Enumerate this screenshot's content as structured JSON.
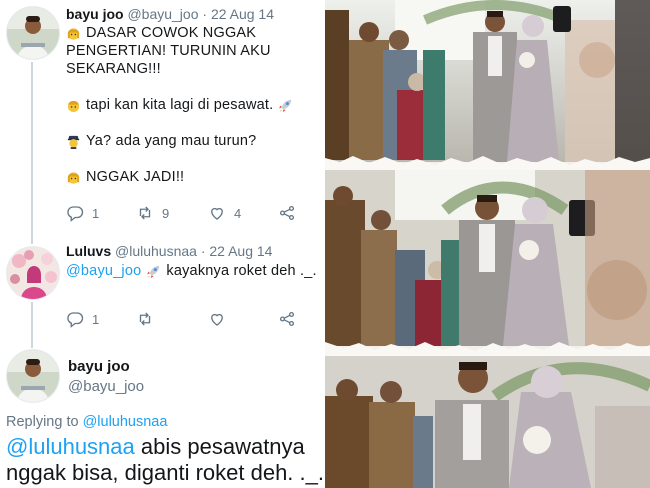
{
  "tweet1": {
    "name": "bayu joo",
    "handle": "@bayu_joo",
    "date": "· 22 Aug 14",
    "lines": [
      "DASAR COWOK NGGAK",
      "PENGERTIAN! TURUNIN AKU",
      "SEKARANG!!!",
      "tapi kan kita lagi di pesawat.",
      "Ya? ada yang mau turun?",
      "NGGAK JADI!!"
    ],
    "reply_count": "1",
    "retweet_count": "9",
    "like_count": "4"
  },
  "tweet2": {
    "name": "Luluvs",
    "handle": "@luluhusnaa",
    "date": "· 22 Aug 14",
    "mention": "@bayu_joo",
    "text": "kayaknya roket deh ._.",
    "reply_count": "1"
  },
  "tweet3": {
    "name": "bayu joo",
    "handle": "@bayu_joo",
    "replying_label": "Replying to",
    "replying_handle": "@luluhusnaa",
    "mention": "@luluhusnaa",
    "text_part1": "abis pesawatnya",
    "text_part2": "nggak bisa, diganti roket deh. ._."
  },
  "colors": {
    "link": "#1da1f2",
    "muted": "#657786",
    "text": "#14171a",
    "divider": "#e6ecf0"
  },
  "icons": [
    "reply-icon",
    "retweet-icon",
    "like-icon",
    "share-icon",
    "rocket-emoji",
    "woman-emoji",
    "man-emoji",
    "pilot-emoji"
  ]
}
